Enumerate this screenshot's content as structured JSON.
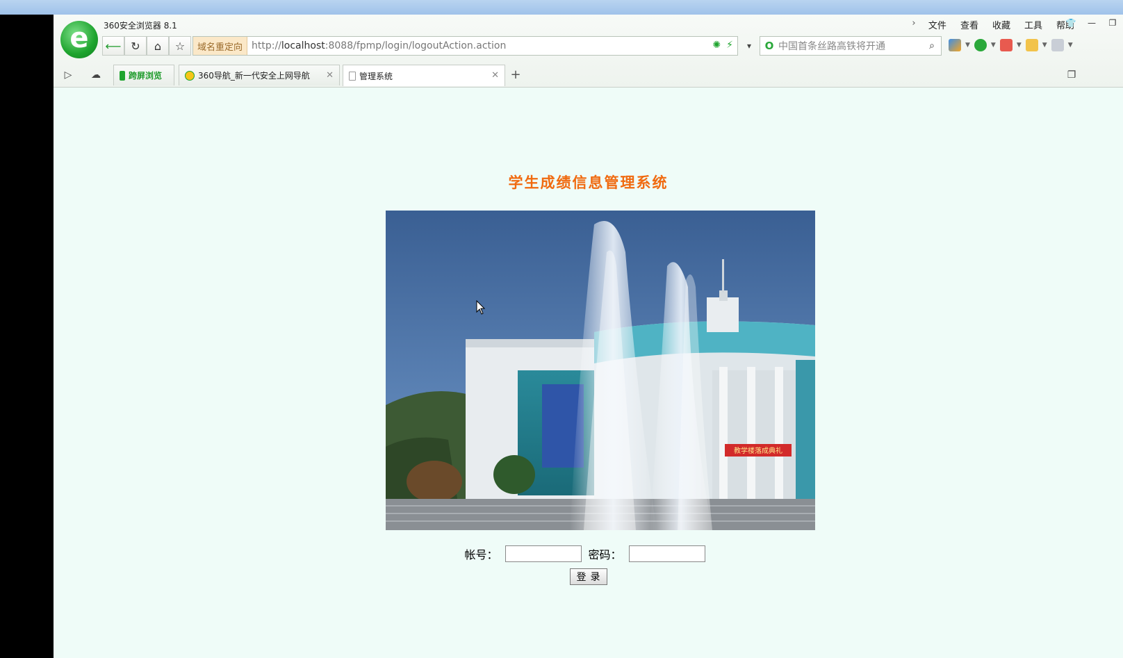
{
  "window": {
    "app_title": "360安全浏览器 8.1"
  },
  "menu": [
    "文件",
    "查看",
    "收藏",
    "工具",
    "帮助"
  ],
  "address_bar": {
    "redirect_label": "域名重定向",
    "url_prefix": "http://",
    "url_host": "localhost",
    "url_rest": ":8088/fpmp/login/logoutAction.action"
  },
  "search": {
    "placeholder": "中国首条丝路高铁将开通"
  },
  "tabs": [
    {
      "label": "跨屏浏览",
      "active": false
    },
    {
      "label": "360导航_新一代安全上网导航",
      "active": false
    },
    {
      "label": "管理系统",
      "active": true
    }
  ],
  "page": {
    "title": "学生成绩信息管理系统",
    "banner_text": "教学楼落成典礼",
    "login": {
      "account_label": "帐号：",
      "password_label": "密码：",
      "account_value": "",
      "password_value": "",
      "submit_label": "登录"
    }
  },
  "colors": {
    "title": "#f06a10",
    "page_bg": "#effcf8",
    "brand_green": "#1ea42e"
  }
}
